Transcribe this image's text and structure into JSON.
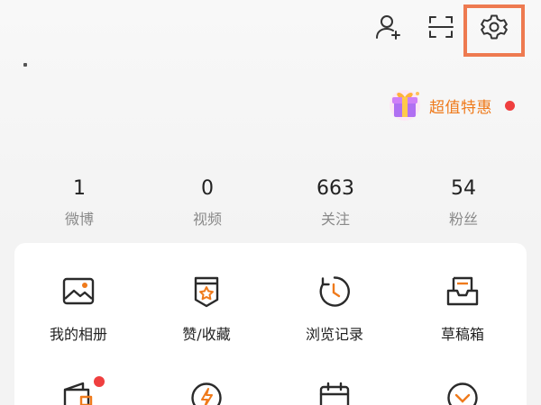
{
  "header": {
    "icons": [
      "add-friend-icon",
      "scan-icon",
      "settings-icon"
    ]
  },
  "promo": {
    "label": "超值特惠",
    "icon": "gift-box-icon",
    "badge": "red-dot"
  },
  "stats": [
    {
      "value": "1",
      "label": "微博"
    },
    {
      "value": "0",
      "label": "视频"
    },
    {
      "value": "663",
      "label": "关注"
    },
    {
      "value": "54",
      "label": "粉丝"
    }
  ],
  "grid": {
    "row1": [
      {
        "label": "我的相册",
        "icon": "photo-album-icon"
      },
      {
        "label": "赞/收藏",
        "icon": "like-favorite-icon"
      },
      {
        "label": "浏览记录",
        "icon": "history-clock-icon"
      },
      {
        "label": "草稿箱",
        "icon": "drafts-tray-icon"
      }
    ],
    "row2": [
      {
        "icon": "wallet-icon",
        "badge": "red-dot"
      },
      {
        "icon": "lightning-icon"
      },
      {
        "icon": "calendar-icon"
      },
      {
        "icon": "smile-icon"
      }
    ]
  },
  "colors": {
    "accent_orange": "#ef7a1b",
    "highlight_border": "#ee7a50",
    "badge_red": "#ef3f3f",
    "text_primary": "#222222",
    "text_secondary": "#8a8a8a"
  }
}
